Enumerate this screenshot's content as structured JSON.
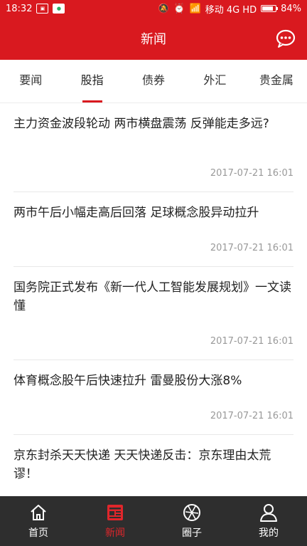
{
  "status_bar": {
    "time": "18:32",
    "carrier": "移动 4G HD",
    "battery": "84%",
    "battery_level": 0.84
  },
  "header": {
    "title": "新闻"
  },
  "tabs": [
    {
      "label": "要闻"
    },
    {
      "label": "股指",
      "active": true
    },
    {
      "label": "债券"
    },
    {
      "label": "外汇"
    },
    {
      "label": "贵金属"
    }
  ],
  "news": [
    {
      "title": "主力资金波段轮动 两市横盘震荡 反弹能走多远?",
      "time": "2017-07-21 16:01"
    },
    {
      "title": "两市午后小幅走高后回落  足球概念股异动拉升",
      "time": "2017-07-21 16:01"
    },
    {
      "title": "国务院正式发布《新一代人工智能发展规划》一文读懂",
      "time": "2017-07-21 16:01"
    },
    {
      "title": "体育概念股午后快速拉升 雷曼股份大涨8%",
      "time": "2017-07-21 16:01"
    },
    {
      "title": "京东封杀天天快递 天天快递反击：京东理由太荒谬！",
      "time": ""
    }
  ],
  "bottom_nav": [
    {
      "label": "首页",
      "icon": "home-icon"
    },
    {
      "label": "新闻",
      "icon": "news-icon",
      "active": true
    },
    {
      "label": "圈子",
      "icon": "circle-icon"
    },
    {
      "label": "我的",
      "icon": "profile-icon"
    }
  ],
  "colors": {
    "brand_red": "#d9191f",
    "nav_bg": "#2e2e2e"
  }
}
